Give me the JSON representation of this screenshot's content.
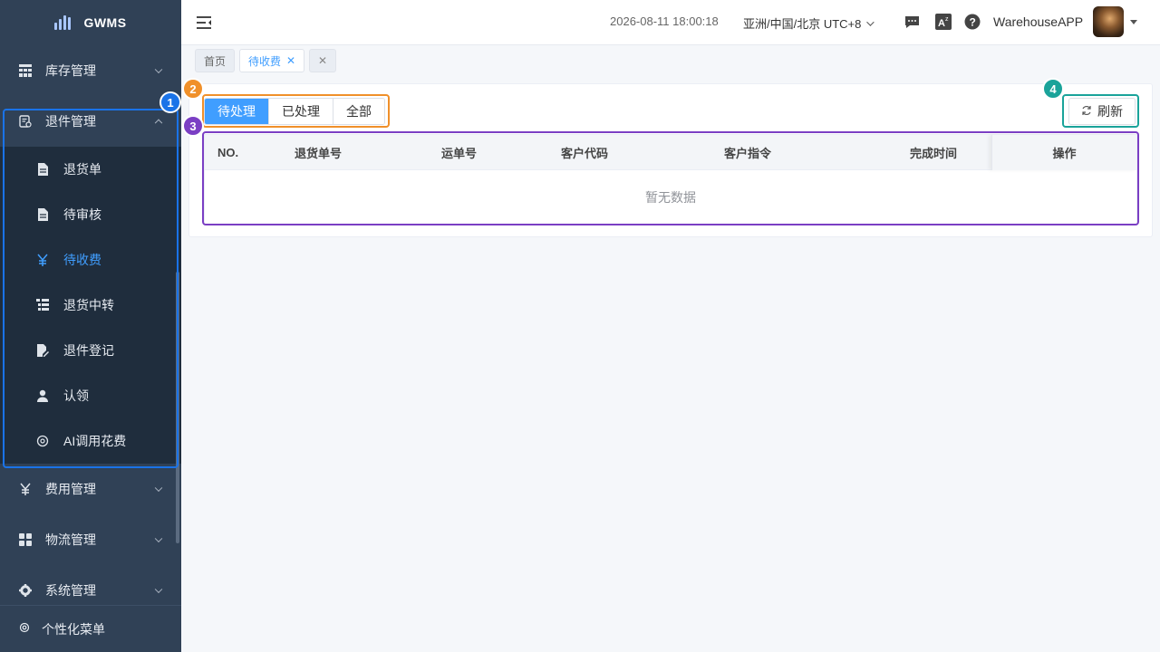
{
  "app": {
    "name": "GWMS"
  },
  "sidebar": {
    "menus": [
      {
        "label": "库存管理",
        "icon": "grid-table-icon",
        "expanded": false
      },
      {
        "label": "退件管理",
        "icon": "return-doc-icon",
        "expanded": true
      }
    ],
    "submenu": [
      {
        "label": "退货单",
        "icon": "document-icon",
        "active": false
      },
      {
        "label": "待审核",
        "icon": "document-icon",
        "active": false
      },
      {
        "label": "待收费",
        "icon": "yen-icon",
        "active": true
      },
      {
        "label": "退货中转",
        "icon": "list-tree-icon",
        "active": false
      },
      {
        "label": "退件登记",
        "icon": "edit-doc-icon",
        "active": false
      },
      {
        "label": "认领",
        "icon": "user-icon",
        "active": false
      },
      {
        "label": "AI调用花费",
        "icon": "coin-icon",
        "active": false
      }
    ],
    "menus_after": [
      {
        "label": "费用管理",
        "icon": "yen-icon"
      },
      {
        "label": "物流管理",
        "icon": "apps-icon"
      },
      {
        "label": "系统管理",
        "icon": "gear-icon"
      }
    ],
    "footer": {
      "label": "个性化菜单",
      "icon": "settings-icon"
    }
  },
  "header": {
    "datetime": "2026-08-11 18:00:18",
    "timezone": "亚洲/中国/北京 UTC+8",
    "username": "WarehouseAPP"
  },
  "tags": [
    {
      "label": "首页",
      "active": false,
      "closable": false
    },
    {
      "label": "待收费",
      "active": true,
      "closable": true
    },
    {
      "label": "",
      "active": false,
      "closable": true
    }
  ],
  "filters": {
    "tabs": [
      {
        "label": "待处理",
        "selected": true
      },
      {
        "label": "已处理",
        "selected": false
      },
      {
        "label": "全部",
        "selected": false
      }
    ]
  },
  "toolbar": {
    "refresh_label": "刷新"
  },
  "table": {
    "columns": [
      "NO.",
      "退货单号",
      "运单号",
      "客户代码",
      "客户指令",
      "完成时间",
      "操作"
    ],
    "empty_text": "暂无数据"
  },
  "annotations": [
    {
      "number": "1",
      "color": "#1a73e8"
    },
    {
      "number": "2",
      "color": "#f0902a"
    },
    {
      "number": "3",
      "color": "#7b3fc4"
    },
    {
      "number": "4",
      "color": "#1aa39a"
    }
  ],
  "colors": {
    "sidebar_bg": "#304156",
    "submenu_bg": "#1f2d3d",
    "accent": "#409eff"
  }
}
